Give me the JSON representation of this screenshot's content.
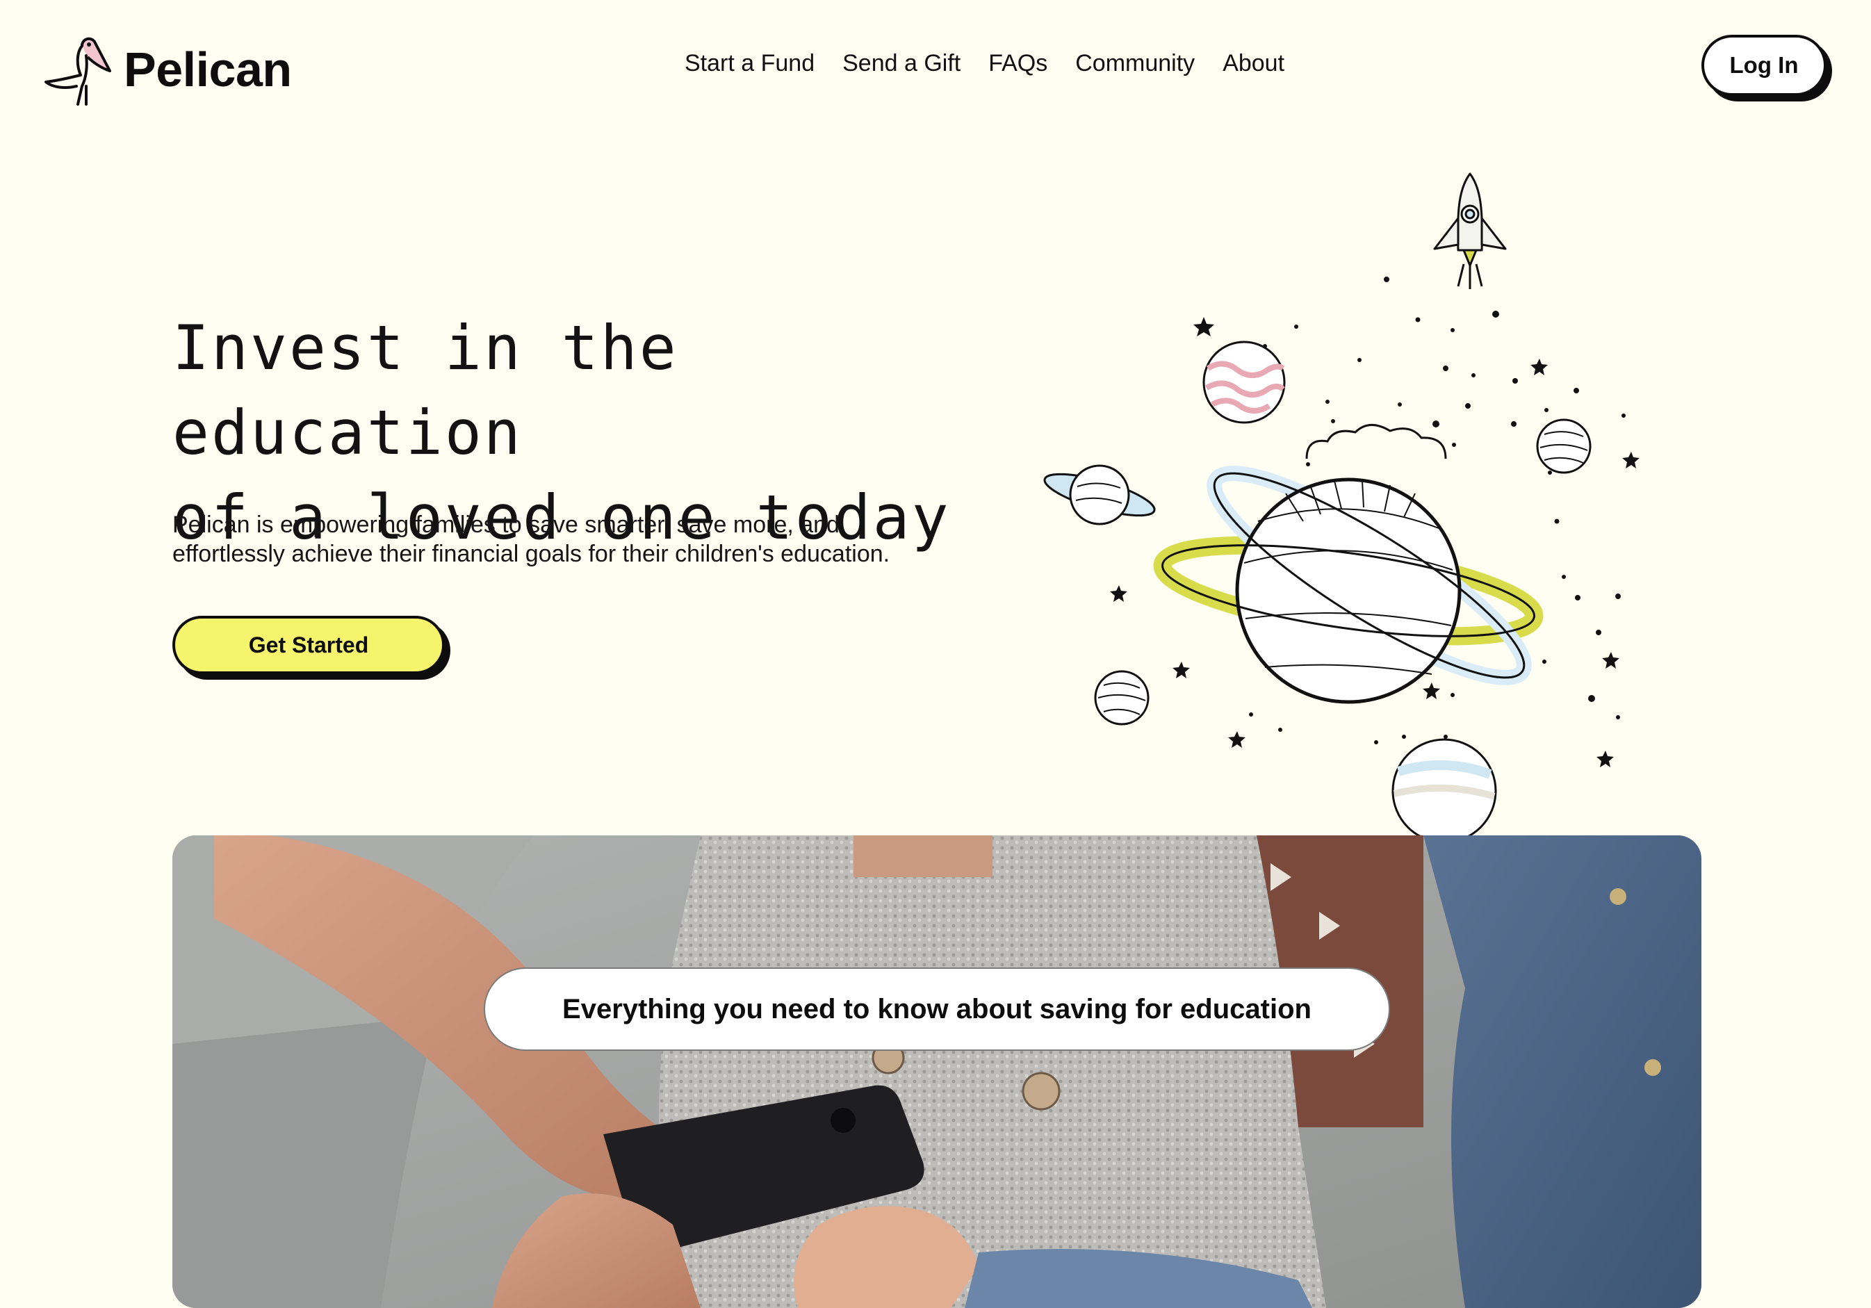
{
  "brand": {
    "name": "Pelican",
    "logo_icon": "pelican-icon"
  },
  "nav": {
    "items": [
      {
        "label": "Start a Fund"
      },
      {
        "label": "Send a Gift"
      },
      {
        "label": "FAQs"
      },
      {
        "label": "Community"
      },
      {
        "label": "About"
      }
    ],
    "login_label": "Log In"
  },
  "hero": {
    "title_line1": "Invest in the education",
    "title_line2": "of a loved one today",
    "subtitle_line1": "Pelican is empowering families to save smarter, save more, and",
    "subtitle_line2": "effortlessly achieve their financial goals for their children's education.",
    "cta_label": "Get Started"
  },
  "feature": {
    "pill_label": "Everything you need to know about saving for education"
  },
  "colors": {
    "background": "#fefef2",
    "accent_yellow": "#f6f36c",
    "ring_blue": "#d9ecf7",
    "ring_yellow": "#d8dc4a",
    "text": "#0d0d0d"
  }
}
